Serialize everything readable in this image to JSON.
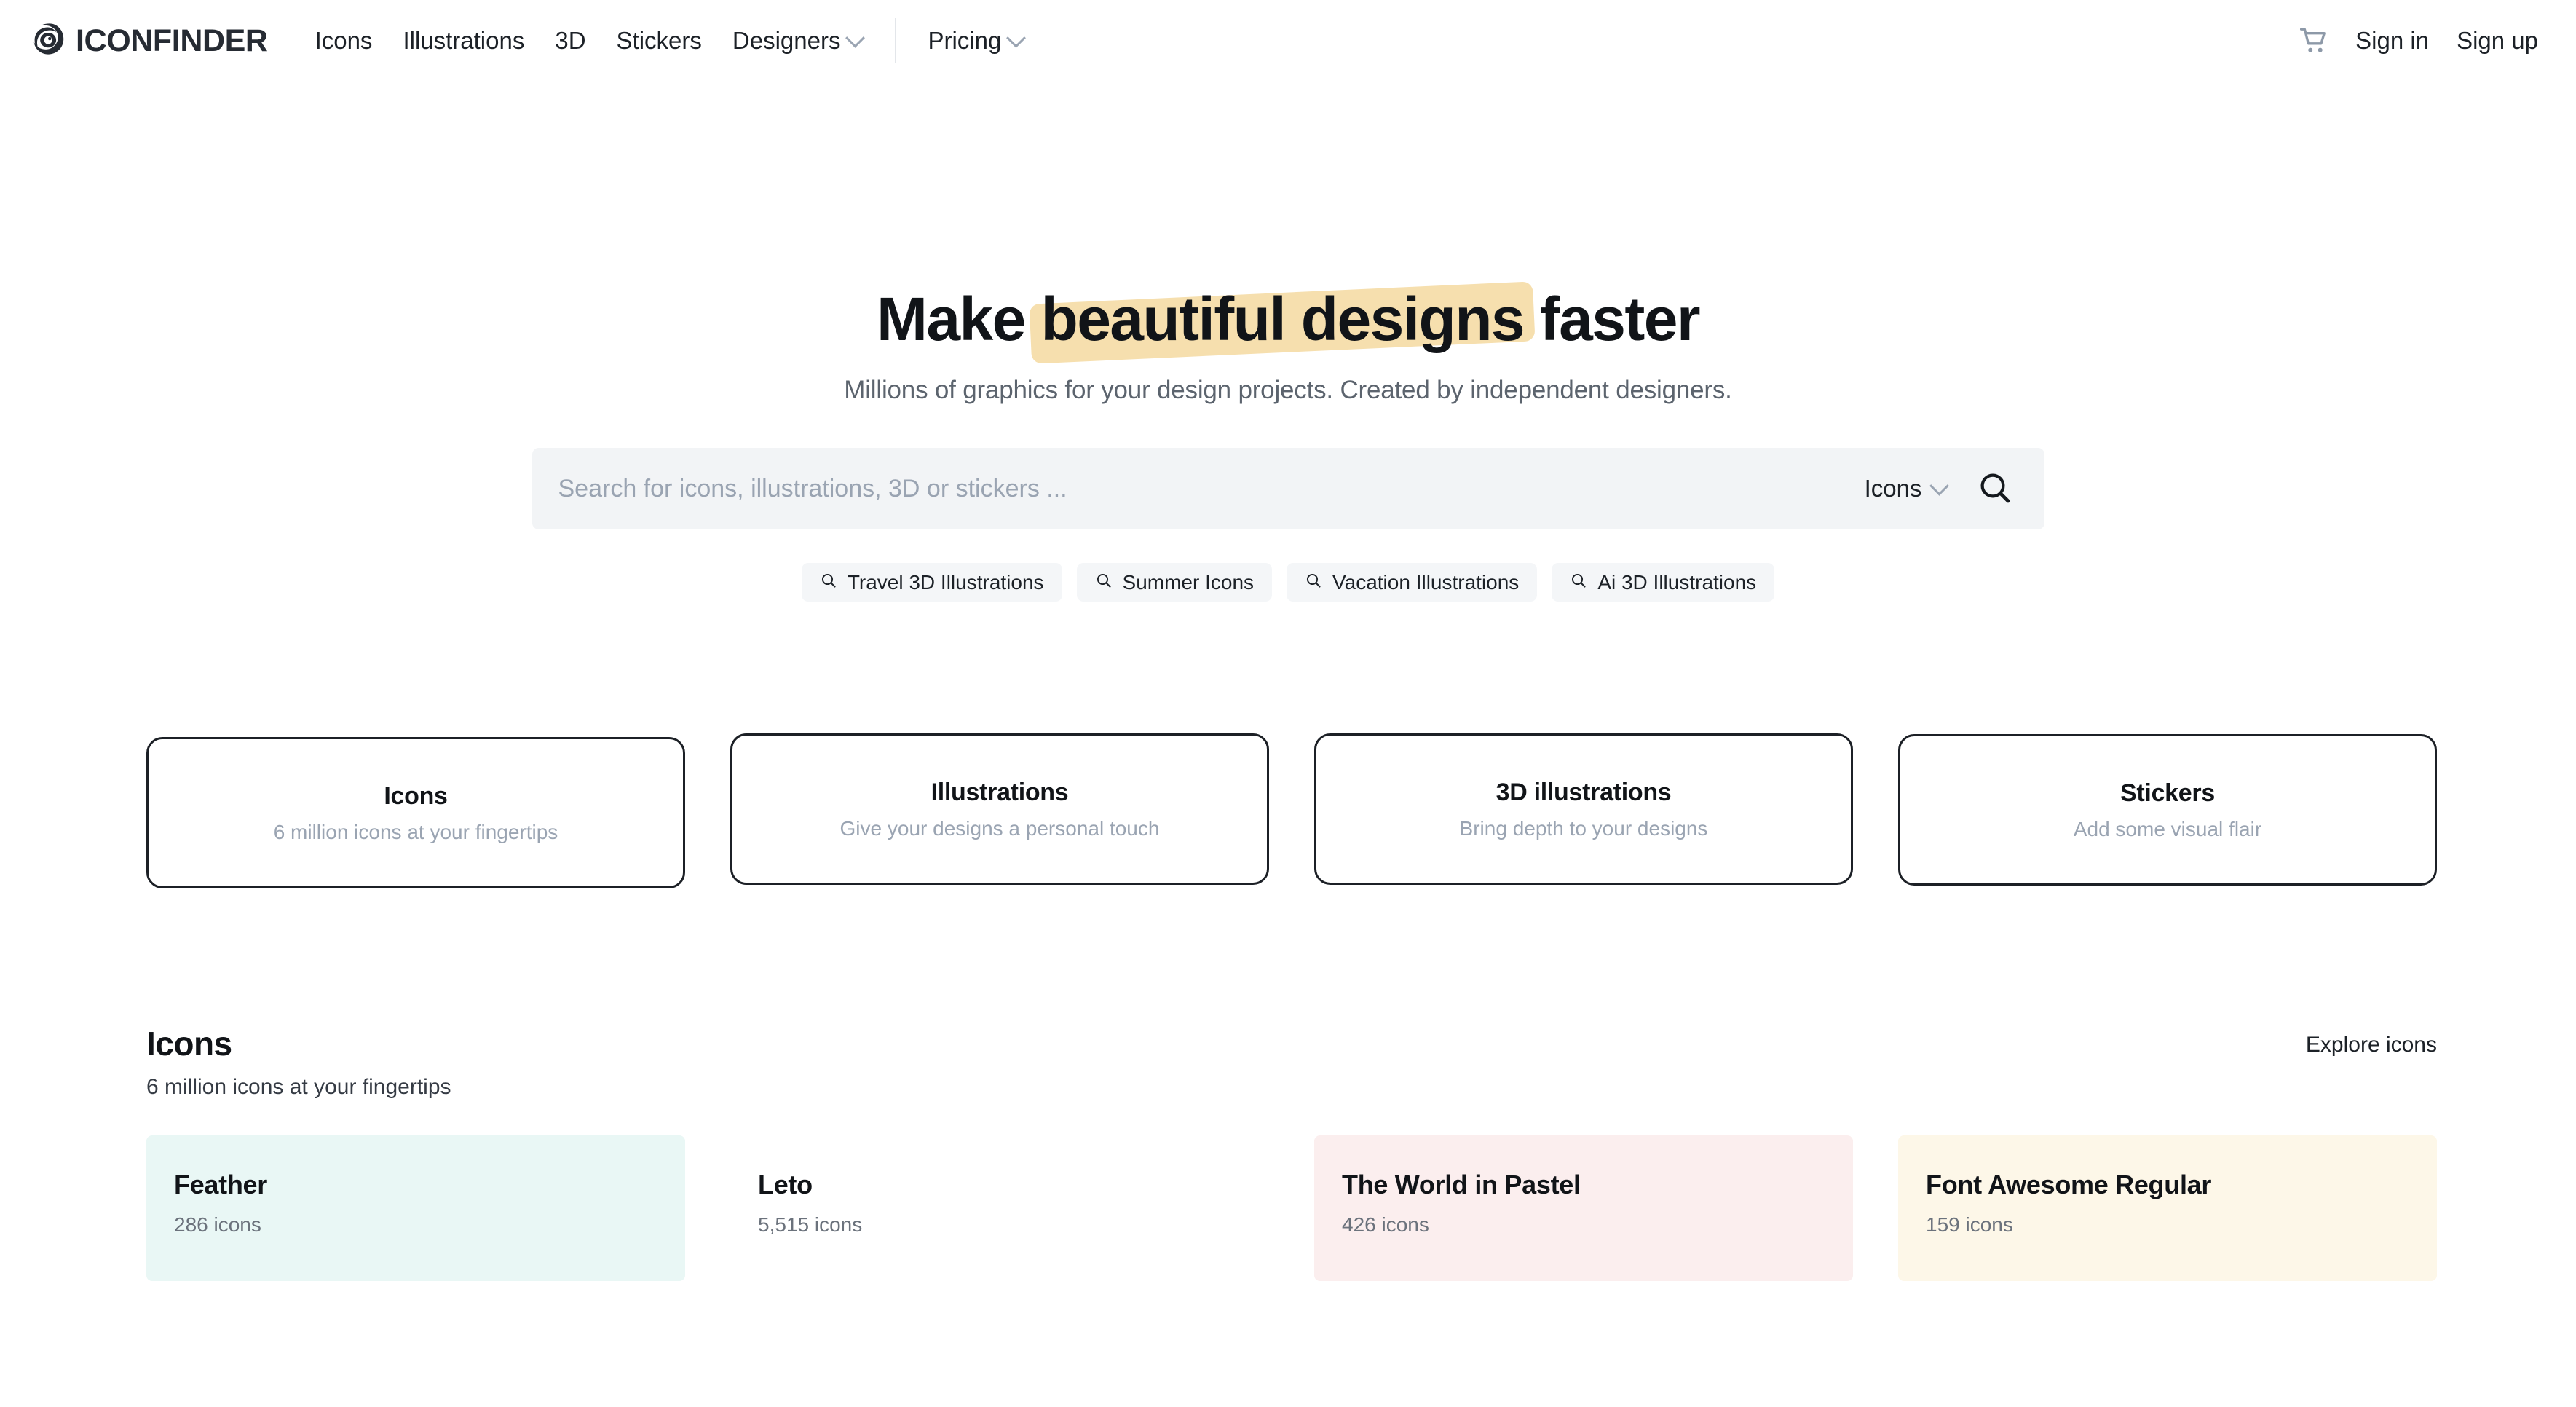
{
  "header": {
    "logo_text": "ICONFINDER",
    "logo_icon": "iconfinder-eye-logo",
    "nav": [
      {
        "label": "Icons",
        "has_dropdown": false
      },
      {
        "label": "Illustrations",
        "has_dropdown": false
      },
      {
        "label": "3D",
        "has_dropdown": false
      },
      {
        "label": "Stickers",
        "has_dropdown": false
      },
      {
        "label": "Designers",
        "has_dropdown": true
      }
    ],
    "nav_after_divider": [
      {
        "label": "Pricing",
        "has_dropdown": true
      }
    ],
    "cart_icon": "shopping-cart-icon",
    "sign_in": "Sign in",
    "sign_up": "Sign up"
  },
  "hero": {
    "headline_before": "Make ",
    "headline_highlight": "beautiful designs",
    "headline_after": " faster",
    "highlight_color": "#f6dfae",
    "subhead": "Millions of graphics for your design projects. Created by independent designers."
  },
  "search": {
    "placeholder": "Search for icons, illustrations, 3D or stickers ...",
    "value": "",
    "type_selected": "Icons",
    "search_icon": "magnifier-icon"
  },
  "chips": [
    {
      "label": "Travel 3D Illustrations",
      "icon": "magnifier-icon"
    },
    {
      "label": "Summer Icons",
      "icon": "magnifier-icon"
    },
    {
      "label": "Vacation Illustrations",
      "icon": "magnifier-icon"
    },
    {
      "label": "Ai 3D Illustrations",
      "icon": "magnifier-icon"
    }
  ],
  "categories": [
    {
      "title": "Icons",
      "subtitle": "6 million icons at your fingertips"
    },
    {
      "title": "Illustrations",
      "subtitle": "Give your designs a personal touch"
    },
    {
      "title": "3D illustrations",
      "subtitle": "Bring depth to your designs"
    },
    {
      "title": "Stickers",
      "subtitle": "Add some visual flair"
    }
  ],
  "icons_section": {
    "title": "Icons",
    "subtitle": "6 million icons at your fingertips",
    "explore_link": "Explore icons",
    "sets": [
      {
        "name": "Feather",
        "count": "286 icons",
        "bg": "#e9f7f5"
      },
      {
        "name": "Leto",
        "count": "5,515 icons",
        "bg": "#ffffff"
      },
      {
        "name": "The World in Pastel",
        "count": "426 icons",
        "bg": "#fbeeee"
      },
      {
        "name": "Font Awesome Regular",
        "count": "159 icons",
        "bg": "#fdf7e8"
      }
    ]
  }
}
